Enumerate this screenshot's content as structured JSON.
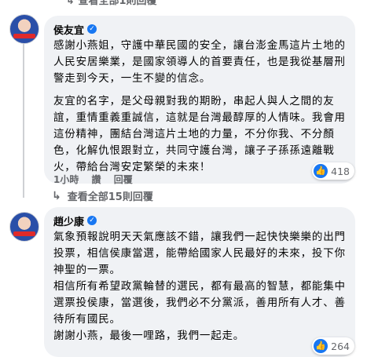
{
  "header": {
    "replies_link": "查看全部1則回覆"
  },
  "comments": [
    {
      "author": "侯友宜",
      "verified": true,
      "paragraphs": [
        "感謝小燕姐，守護中華民國的安全，讓台澎金馬這片土地的人民安居樂業，是國家領導人的首要責任，也是我從基層刑警走到今天，一生不變的信念。",
        "友宜的名字，是父母親對我的期盼，串起人與人之間的友誼，重情重義重誠信，這就是台灣最醇厚的人情味。我會用這份精神，團結台灣這片土地的力量，不分你我、不分顏色，化解仇恨跟對立，共同守護台灣，讓子子孫孫遠離戰火，帶給台灣安定繁榮的未來！"
      ],
      "time": "1小時",
      "like": "讚",
      "reply": "回覆",
      "reaction_count": "418",
      "view_replies": "查看全部15則回覆"
    },
    {
      "author": "趙少康",
      "verified": true,
      "paragraphs": [
        "氣象預報說明天天氣應該不錯，讓我們一起快快樂樂的出門投票，相信侯康當選，能帶給國家人民最好的未來，投下你神聖的一票。",
        "相信所有希望政黨輪替的選民，都有最高的智慧，都能集中選票投侯康，當選後，我們必不分黨派，善用所有人才、善待所有國民。",
        "謝謝小燕，最後一哩路，我們一起走。"
      ],
      "reaction_count": "264"
    }
  ],
  "colors": {
    "accent": "#1877f2",
    "bubble": "#f0f2f5",
    "meta": "#65676b"
  }
}
